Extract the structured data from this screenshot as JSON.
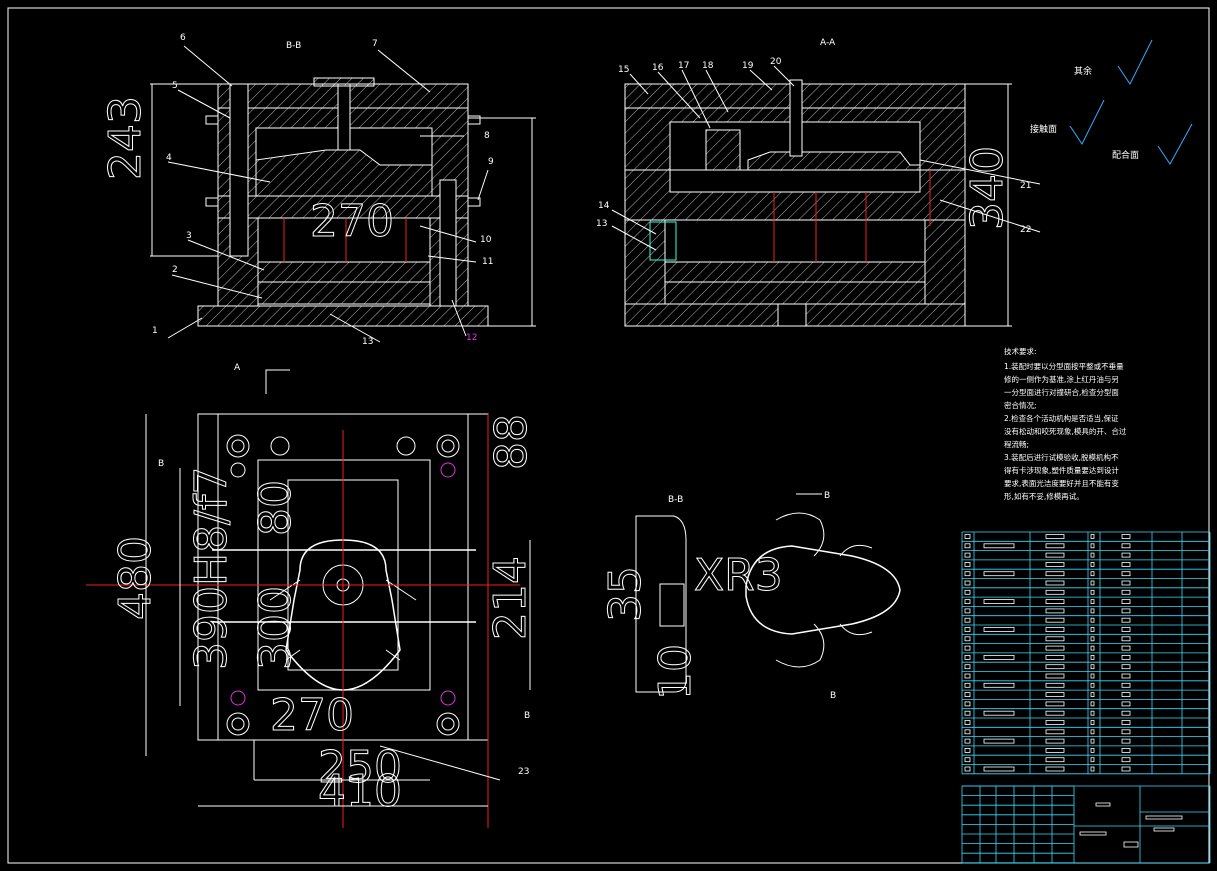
{
  "views": {
    "bb_title": "B-B",
    "aa_title": "A-A",
    "bb_small_title": "B-B",
    "plan_letter_a": "A",
    "plan_letter_b": "B",
    "plan_letter_b2": "B",
    "part_letter_b_top": "B",
    "part_letter_b_bottom": "B"
  },
  "section_bb_callouts": [
    "1",
    "2",
    "3",
    "4",
    "5",
    "6",
    "7",
    "8",
    "9",
    "10",
    "11",
    "12",
    "13"
  ],
  "section_aa_callouts": [
    "13",
    "14",
    "15",
    "16",
    "17",
    "18",
    "19",
    "20",
    "21",
    "22"
  ],
  "plan_callout": "23",
  "dimensions": {
    "bb_height": "243",
    "bb_mid": "270",
    "aa_height": "340",
    "plan_480": "480",
    "plan_390": "390H8/f7",
    "plan_300": "300",
    "plan_214": "214",
    "plan_88": "88",
    "plan_250": "250",
    "plan_410": "410",
    "plan_80": "80",
    "plan_270": "270",
    "part_r3": "XR3",
    "part_10": "10",
    "part_35": "35"
  },
  "surface_symbols": {
    "rest": "其余",
    "contact": "接触面",
    "mating": "配合面"
  },
  "technical_requirements": {
    "heading": "技术要求:",
    "lines": [
      "1.装配时要以分型面按平整或不垂量",
      "修的一侧作为基准,涂上红丹油与另",
      "一分型面进行对撞研合,检查分型面",
      "密合情况;",
      "2.检查各个活动机构是否适当,保证",
      "没有松动和咬死现象,模具的开、合过",
      "程流畅;",
      "3.装配后进行试模验收,脱模机构不",
      "得有卡涉现象,塑件质量要达到设计",
      "要求,表面光洁度要好并且不能有变",
      "形,如有不妥,修模再试。"
    ]
  },
  "colors": {
    "background": "#000000",
    "line": "#ffffff",
    "table": "#33ddff",
    "centerline": "#ee2222",
    "highlight": "#dd33dd"
  }
}
